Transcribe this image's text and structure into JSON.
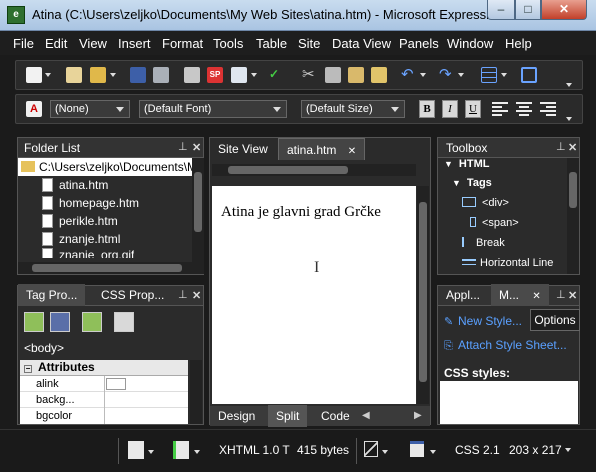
{
  "window": {
    "title": "Atina (C:\\Users\\zeljko\\Documents\\My Web Sites\\atina.htm) - Microsoft Expression ...",
    "min_glyph": "–",
    "max_glyph": "□",
    "close_glyph": "✕"
  },
  "menu": [
    "File",
    "Edit",
    "View",
    "Insert",
    "Format",
    "Tools",
    "Table",
    "Site",
    "Data View",
    "Panels",
    "Window",
    "Help"
  ],
  "formatting": {
    "style_value": "(None)",
    "font_value": "(Default Font)",
    "size_value": "(Default Size)",
    "bold_label": "B",
    "italic_label": "I",
    "underline_label": "U"
  },
  "folder_list": {
    "title": "Folder List",
    "root_path": "C:\\Users\\zeljko\\Documents\\My",
    "files": [
      "atina.htm",
      "homepage.htm",
      "perikle.htm",
      "znanje.html",
      "znanje_org.gif"
    ]
  },
  "editor": {
    "tabs": [
      "Site View",
      "atina.htm"
    ],
    "content": "Atina je glavni grad Grčke",
    "view_tabs": [
      "Design",
      "Split",
      "Code"
    ]
  },
  "toolbox": {
    "title": "Toolbox",
    "section": "HTML",
    "subsection": "Tags",
    "items": [
      "<div>",
      "<span>",
      "Break",
      "Horizontal Line"
    ]
  },
  "tag_panel": {
    "tabs": [
      "Tag Pro...",
      "CSS Prop..."
    ],
    "tag": "<body>",
    "attributes_header": "Attributes",
    "attributes": [
      "alink",
      "backg...",
      "bgcolor"
    ]
  },
  "styles_panel": {
    "tabs": [
      "Appl...",
      "M..."
    ],
    "new_style": "New Style...",
    "options": "Options",
    "attach": "Attach Style Sheet...",
    "css_styles_label": "CSS styles:"
  },
  "status": {
    "doctype": "XHTML 1.0 T",
    "size": "415 bytes",
    "css": "CSS 2.1",
    "dimensions": "203 x 217"
  },
  "colors": {
    "accent_blue": "#5aa0ff",
    "chrome_dark": "#2b2b2b"
  }
}
